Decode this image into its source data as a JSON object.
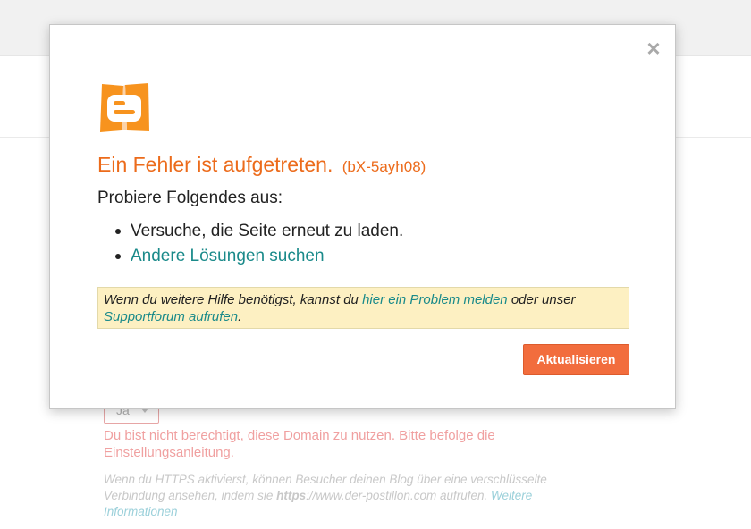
{
  "background": {
    "select_value": "Ja",
    "error_text": "Du bist nicht berechtigt, diese Domain zu nutzen. Bitte befolge die Einstellungsanleitung.",
    "info_prefix": "Wenn du HTTPS aktivierst, können Besucher deinen Blog über eine verschlüsselte Verbindung ansehen, indem sie ",
    "info_https": "https",
    "info_url": "://www.der-postillon.com aufrufen. ",
    "info_link": "Weitere Informationen"
  },
  "modal": {
    "close_label": "×",
    "logo_icon": "blogger-logo-icon",
    "title": "Ein Fehler ist aufgetreten.",
    "error_code": "(bX-5ayh08)",
    "subtitle": "Probiere Folgendes aus:",
    "steps": [
      "Versuche, die Seite erneut zu laden.",
      "Andere Lösungen suchen"
    ],
    "help": {
      "prefix": "Wenn du weitere Hilfe benötigst, kannst du ",
      "report_link": "hier ein Problem melden",
      "middle": " oder unser ",
      "forum_link": "Supportforum aufrufen",
      "suffix": "."
    },
    "refresh_button": "Aktualisieren"
  },
  "colors": {
    "accent": "#ec6b1b",
    "button": "#f26d3d",
    "link": "#1a8a8a",
    "help_background": "#fdf0c2"
  }
}
